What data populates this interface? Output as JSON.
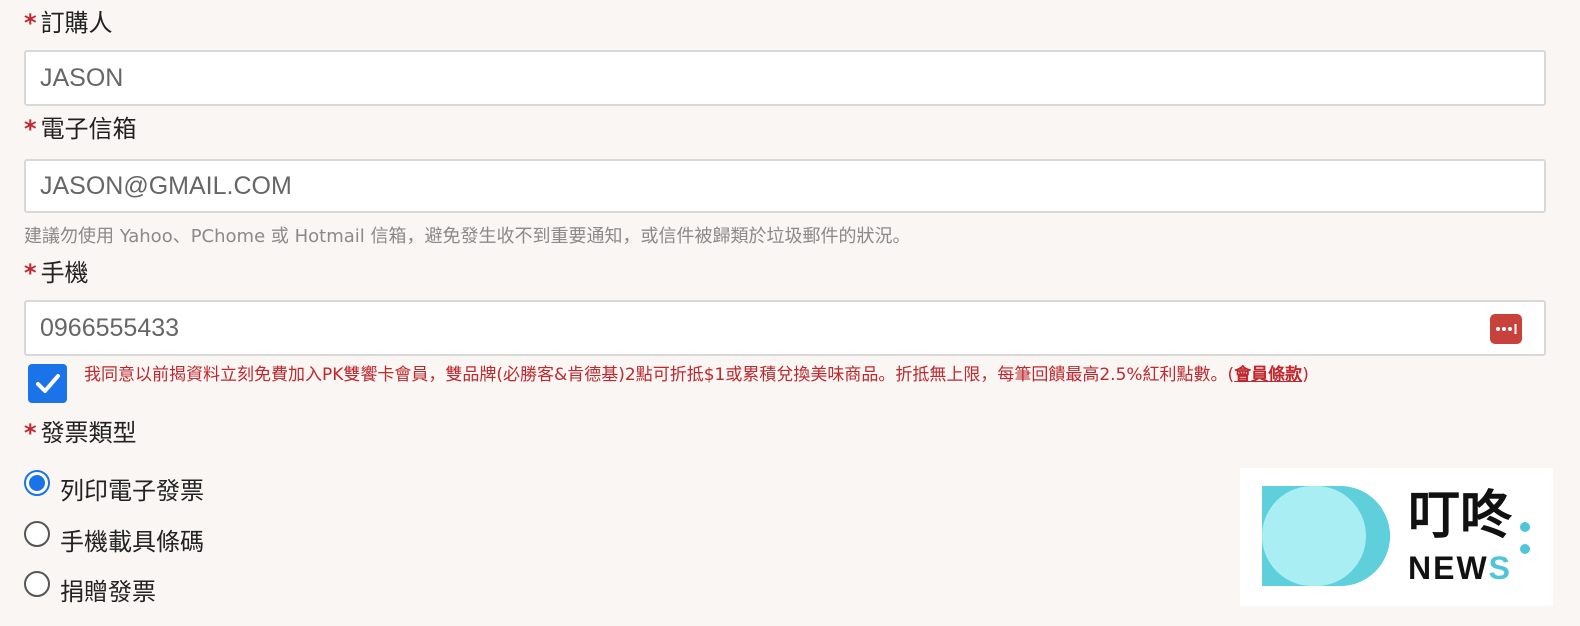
{
  "form": {
    "required_mark": "*",
    "buyer": {
      "label": "訂購人",
      "value": "JASON"
    },
    "email": {
      "label": "電子信箱",
      "value": "JASON@GMAIL.COM",
      "hint": "建議勿使用 Yahoo、PChome 或 Hotmail 信箱，避免發生收不到重要通知，或信件被歸類於垃圾郵件的狀況。"
    },
    "phone": {
      "label": "手機",
      "value": "0966555433",
      "password_manager_icon": "dots-cursor-icon"
    },
    "consent": {
      "checked": true,
      "text": "我同意以前揭資料立刻免費加入PK雙饗卡會員，雙品牌(必勝客&肯德基)2點可折抵$1或累積兌換美味商品。折抵無上限，每筆回饋最高2.5%紅利點數。(",
      "link": "會員條款",
      "text_end": ")"
    },
    "invoice": {
      "label": "發票類型",
      "options": [
        {
          "label": "列印電子發票",
          "selected": true
        },
        {
          "label": "手機載具條碼",
          "selected": false
        },
        {
          "label": "捐贈發票",
          "selected": false
        }
      ]
    }
  },
  "watermark": {
    "name_cn": "叮咚",
    "name_en_main": "NEW",
    "name_en_accent": "S",
    "colors": {
      "teal": "#5fcfdc",
      "light_teal": "#a8eef3",
      "accent": "#4fc6d8"
    }
  },
  "colors": {
    "required": "#c0282f",
    "checkbox": "#1a73e8",
    "background": "#f9f6f3",
    "password_button": "#c8413b"
  }
}
